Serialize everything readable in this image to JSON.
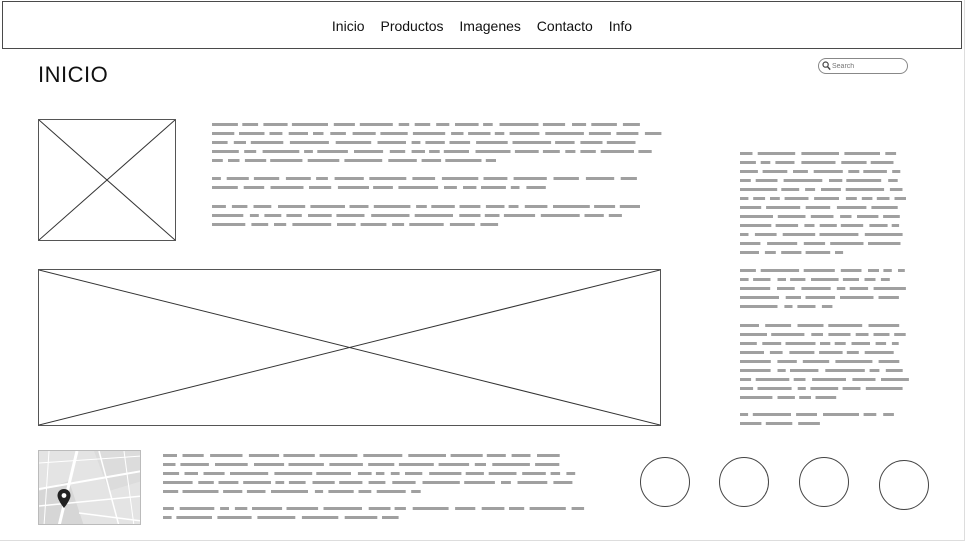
{
  "nav": {
    "items": [
      "Inicio",
      "Productos",
      "Imagenes",
      "Contacto",
      "Info"
    ]
  },
  "page": {
    "title": "INICIO"
  },
  "search": {
    "placeholder": "Search"
  },
  "icons": {
    "search": "search-icon",
    "map_marker": "map-pin-icon"
  },
  "colors": {
    "placeholder_text": "#a0a0a0",
    "border": "#4a4a4a"
  }
}
